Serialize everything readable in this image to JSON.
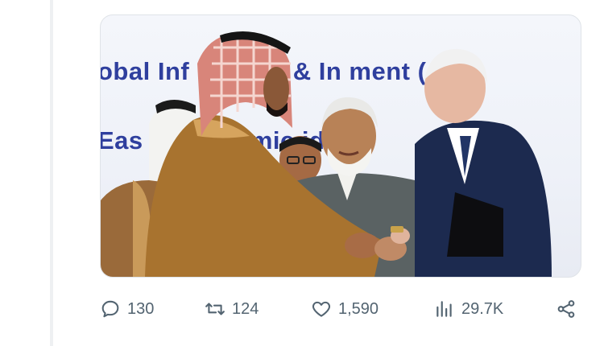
{
  "image": {
    "banner_line_1": "obal Inf   ructure & In     ment (",
    "banner_line_2": "Eas      e Economic      idor"
  },
  "actions": {
    "reply": {
      "icon": "reply-icon",
      "count": "130"
    },
    "retweet": {
      "icon": "retweet-icon",
      "count": "124"
    },
    "like": {
      "icon": "heart-icon",
      "count": "1,590"
    },
    "views": {
      "icon": "views-chart-icon",
      "count": "29.7K"
    },
    "share": {
      "icon": "share-icon"
    }
  },
  "colors": {
    "banner_text": "#2f3f9e",
    "action_gray": "#536471"
  }
}
